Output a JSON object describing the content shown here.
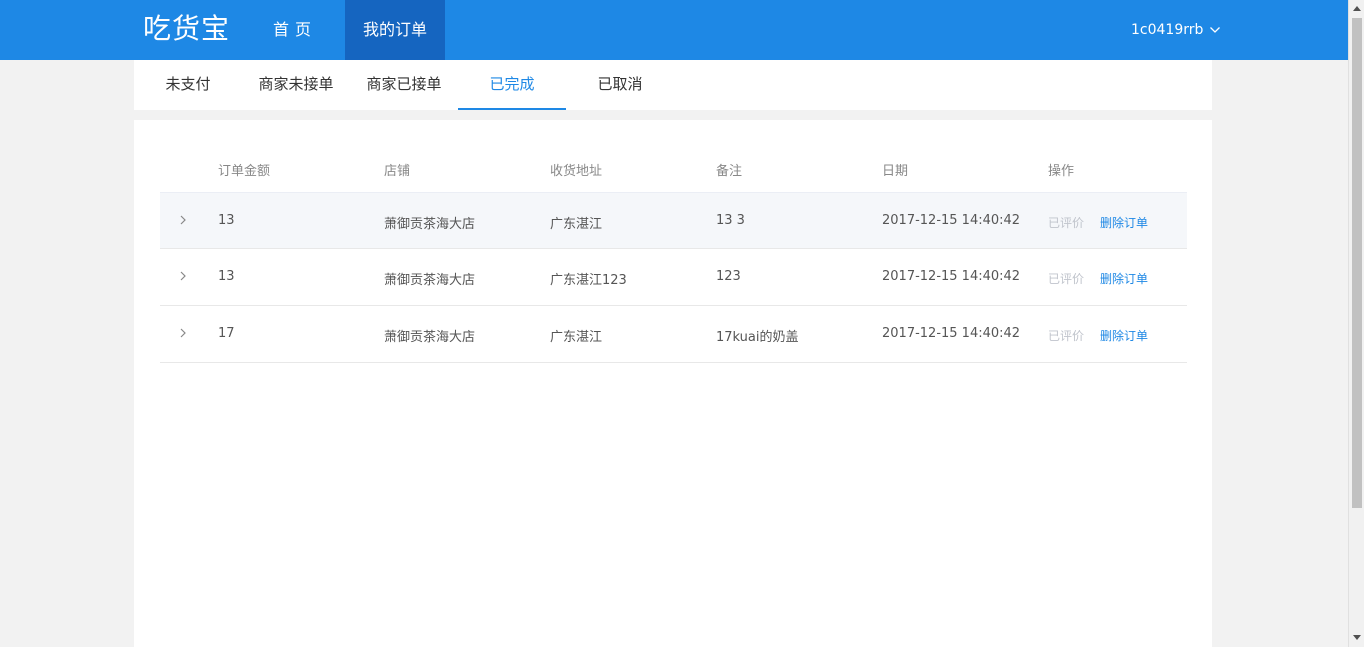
{
  "header": {
    "logo": "吃货宝",
    "nav": [
      {
        "label": "首页"
      },
      {
        "label": "我的订单"
      }
    ],
    "user": "1c0419rrb"
  },
  "tabs": [
    {
      "label": "未支付"
    },
    {
      "label": "商家未接单"
    },
    {
      "label": "商家已接单"
    },
    {
      "label": "已完成",
      "active": true
    },
    {
      "label": "已取消"
    }
  ],
  "table": {
    "headers": [
      "订单金额",
      "店铺",
      "收货地址",
      "备注",
      "日期",
      "操作"
    ],
    "rows": [
      {
        "amount": "13",
        "shop": "萧御贡茶海大店",
        "address": "广东湛江",
        "note": "13 3",
        "date": "2017-12-15 14:40:42",
        "status": "已评价",
        "action": "删除订单"
      },
      {
        "amount": "13",
        "shop": "萧御贡茶海大店",
        "address": "广东湛江123",
        "note": "123",
        "date": "2017-12-15 14:40:42",
        "status": "已评价",
        "action": "删除订单"
      },
      {
        "amount": "17",
        "shop": "萧御贡茶海大店",
        "address": "广东湛江",
        "note": "17kuai的奶盖",
        "date": "2017-12-15 14:40:42",
        "status": "已评价",
        "action": "删除订单"
      }
    ]
  },
  "colors": {
    "primary": "#1e88e5",
    "nav_active": "#1565c0",
    "background": "#f2f2f2"
  }
}
